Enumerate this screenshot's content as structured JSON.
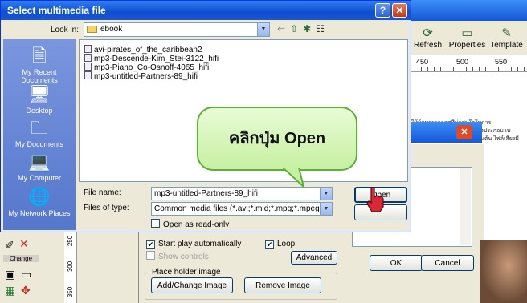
{
  "dialog": {
    "title": "Select multimedia file",
    "look_in_label": "Look in:",
    "look_in_value": "ebook",
    "places": [
      "My Recent Documents",
      "Desktop",
      "My Documents",
      "My Computer",
      "My Network Places"
    ],
    "files": [
      "avi-pirates_of_the_caribbean2",
      "mp3-Descende-Kim_Stei-3122_hifi",
      "mp3-Piano_Co-Osnoff-4065_hifi",
      "mp3-untitled-Partners-89_hifi"
    ],
    "file_name_label": "File name:",
    "file_name_value": "mp3-untitled-Partners-89_hifi",
    "files_of_type_label": "Files of type:",
    "files_of_type_value": "Common media files (*.avi;*.mid;*.mpg;*.mpeg;*.",
    "open_readonly_label": "Open as read-only",
    "open_label": "Open",
    "cancel_label": ""
  },
  "callout": {
    "text": "คลิกปุ่ม Open"
  },
  "app": {
    "toolbar": [
      "Refresh",
      "Properties",
      "Template"
    ],
    "ruler": [
      "450",
      "500",
      "550"
    ],
    "thai_lines": [
      "ุ่ให้ผู้ดบรรยากาศที่น่าสนใจในการ",
      "สียงประกอบ เพ",
      "ส่วนต้น ไฟล์เสียงมี"
    ],
    "left_palette_label": "Change",
    "vruler": [
      "250",
      "300",
      "350"
    ]
  },
  "media_dialog": {
    "start_play_label": "Start play automatically",
    "loop_label": "Loop",
    "show_controls_label": "Show controls",
    "advanced_label": "Advanced",
    "placeholder_group": "Place holder image",
    "add_change_label": "Add/Change Image",
    "remove_label": "Remove Image",
    "ok_label": "OK",
    "cancel_label": "Cancel"
  },
  "colors": {
    "xp_blue": "#0f4ed0",
    "callout_green": "#c6f0a2",
    "callout_border": "#5eaf3a"
  }
}
